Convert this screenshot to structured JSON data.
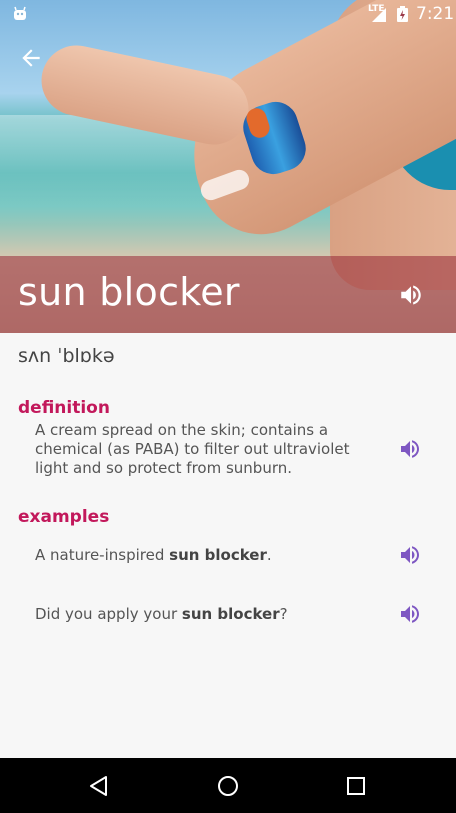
{
  "status_bar": {
    "network": "LTE",
    "time": "7:21"
  },
  "word": {
    "title": "sun blocker",
    "pronunciation": "sʌn ˈblɒkə"
  },
  "definition": {
    "heading": "definition",
    "text": "A cream spread on the skin; contains a chemical (as PABA) to filter out ultraviolet light and so protect from sunburn."
  },
  "examples": {
    "heading": "examples",
    "items": [
      {
        "before": "A nature-inspired ",
        "bold": "sun blocker",
        "after": "."
      },
      {
        "before": "Did you apply your ",
        "bold": "sun blocker",
        "after": "?"
      }
    ]
  },
  "colors": {
    "accent": "#c2185b",
    "speaker_icon": "#7e57c2",
    "title_band": "#96283788"
  },
  "icons": {
    "back": "arrow-left-icon",
    "speaker": "volume-up-icon",
    "nav": [
      "back-triangle-icon",
      "home-circle-icon",
      "recents-square-icon"
    ]
  }
}
